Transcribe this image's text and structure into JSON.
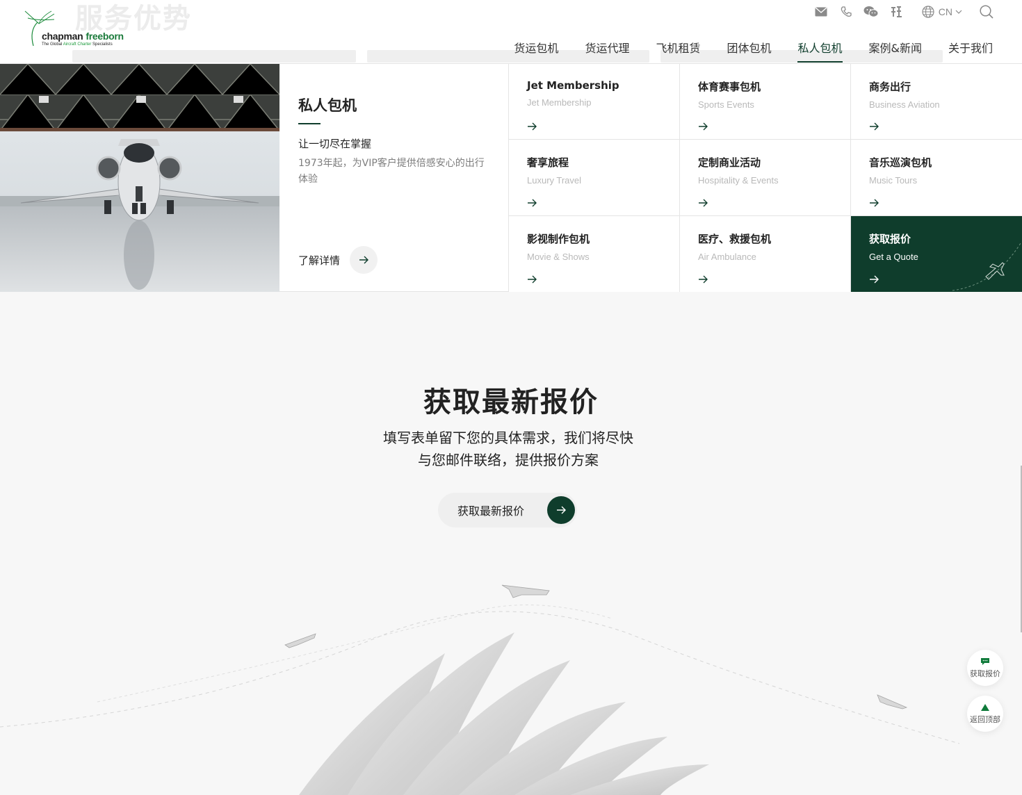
{
  "brand": {
    "name_part1": "chapman",
    "name_part2": "freeborn",
    "tagline_pre": "The Global ",
    "tagline_green": "Aircraft Charter",
    "tagline_post": " Specialists",
    "ghost_title": "服务优势"
  },
  "top_icons": [
    "mail-icon",
    "phone-icon",
    "wechat-icon",
    "weibo-icon"
  ],
  "language": {
    "current": "CN"
  },
  "nav": {
    "items": [
      {
        "label": "货运包机"
      },
      {
        "label": "货运代理"
      },
      {
        "label": "飞机租赁"
      },
      {
        "label": "团体包机"
      },
      {
        "label": "私人包机"
      },
      {
        "label": "案例&新闻"
      },
      {
        "label": "关于我们"
      }
    ],
    "active_index": 4
  },
  "mega": {
    "title": "私人包机",
    "subtitle": "让一切尽在掌握",
    "description": "1973年起，为VIP客户提供倍感安心的出行体验",
    "more_label": "了解详情",
    "items": [
      {
        "title": "Jet Membership",
        "subtitle": "Jet Membership"
      },
      {
        "title": "体育赛事包机",
        "subtitle": "Sports Events"
      },
      {
        "title": "商务出行",
        "subtitle": "Business Aviation"
      },
      {
        "title": "奢享旅程",
        "subtitle": "Luxury Travel"
      },
      {
        "title": "定制商业活动",
        "subtitle": "Hospitality & Events"
      },
      {
        "title": "音乐巡演包机",
        "subtitle": "Music Tours"
      },
      {
        "title": "影视制作包机",
        "subtitle": "Movie & Shows"
      },
      {
        "title": "医疗、救援包机",
        "subtitle": "Air Ambulance"
      },
      {
        "title": "获取报价",
        "subtitle": "Get a Quote"
      }
    ]
  },
  "quote_section": {
    "title": "获取最新报价",
    "desc_line1": "填写表单留下您的具体需求，我们将尽快",
    "desc_line2": "与您邮件联络，提供报价方案",
    "button_label": "获取最新报价"
  },
  "floating": {
    "quote_label": "获取报价",
    "top_label": "返回顶部"
  },
  "colors": {
    "accent": "#0f3d2c",
    "brand_green": "#1a7a3a"
  }
}
